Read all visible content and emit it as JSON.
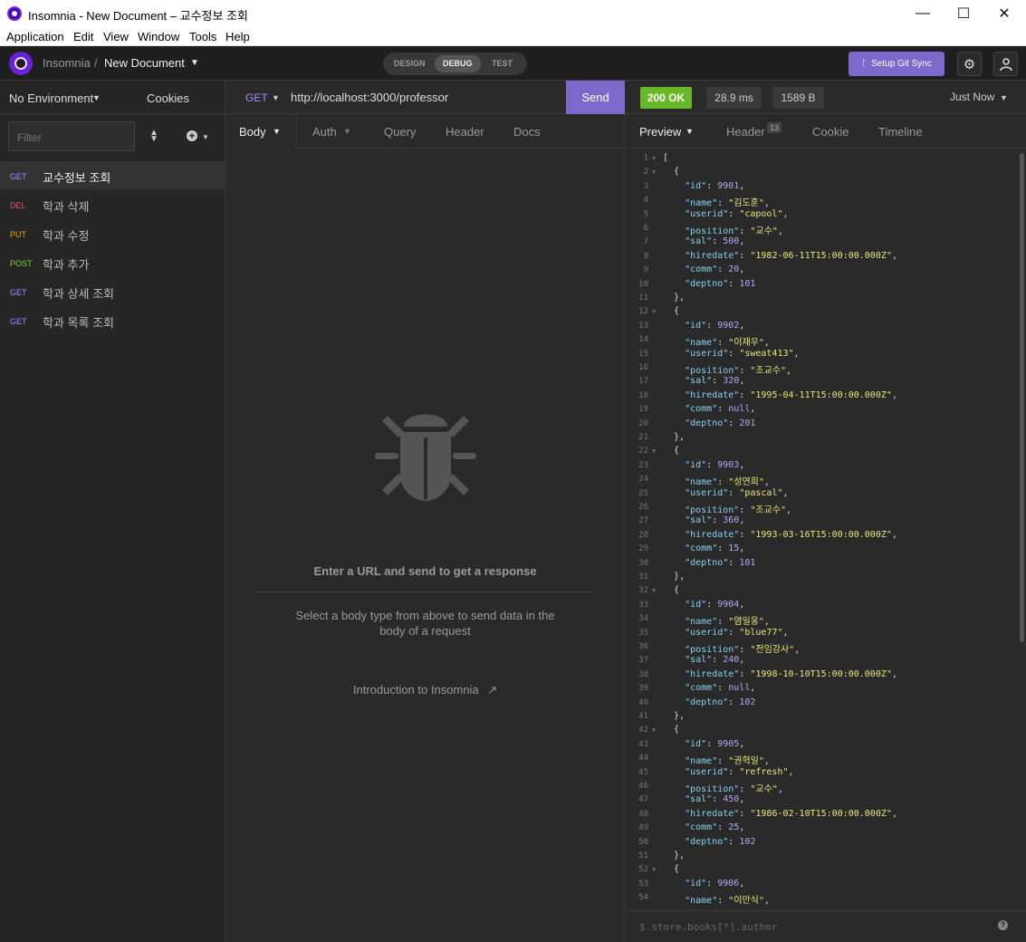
{
  "window": {
    "title": "Insomnia - New Document – 교수정보 조회",
    "minimize": "—",
    "maximize": "☐",
    "close": "✕"
  },
  "menu": [
    "Application",
    "Edit",
    "View",
    "Window",
    "Tools",
    "Help"
  ],
  "header": {
    "app_name": "Insomnia",
    "separator": "/",
    "document": "New Document",
    "tabs": [
      "DESIGN",
      "DEBUG",
      "TEST"
    ],
    "active_tab": "DEBUG",
    "git_button": "Setup Git Sync"
  },
  "sidebar": {
    "environment": "No Environment",
    "cookies": "Cookies",
    "filter_placeholder": "Filter",
    "items": [
      {
        "method": "GET",
        "name": "교수정보 조회",
        "color": "#a78bfa",
        "active": true
      },
      {
        "method": "DEL",
        "name": "학과 삭제",
        "color": "#ef5350",
        "active": false
      },
      {
        "method": "PUT",
        "name": "학과 수정",
        "color": "#f59e0b",
        "active": false
      },
      {
        "method": "POST",
        "name": "학과 추가",
        "color": "#7ed321",
        "active": false
      },
      {
        "method": "GET",
        "name": "학과 상세 조회",
        "color": "#a78bfa",
        "active": false
      },
      {
        "method": "GET",
        "name": "학과 목록 조회",
        "color": "#a78bfa",
        "active": false
      }
    ]
  },
  "request": {
    "method": "GET",
    "url": "http://localhost:3000/professor",
    "send": "Send",
    "tabs": [
      "Body",
      "Auth",
      "Query",
      "Header",
      "Docs"
    ],
    "empty_title": "Enter a URL and send to get a response",
    "empty_desc": "Select a body type from above to send data in the body of a request",
    "intro_link": "Introduction to Insomnia"
  },
  "response": {
    "status": "200 OK",
    "status_color": "#69b827",
    "time": "28.9 ms",
    "size": "1589 B",
    "when": "Just Now",
    "tabs": [
      "Preview",
      "Header",
      "Cookie",
      "Timeline"
    ],
    "header_count": "13",
    "filter_placeholder": "$.store.books[*].author",
    "help": "?",
    "lines": [
      "[",
      "  {",
      "    \"id\": 9901,",
      "    \"name\": \"김도훈\",",
      "    \"userid\": \"capool\",",
      "    \"position\": \"교수\",",
      "    \"sal\": 500,",
      "    \"hiredate\": \"1982-06-11T15:00:00.000Z\",",
      "    \"comm\": 20,",
      "    \"deptno\": 101",
      "  },",
      "  {",
      "    \"id\": 9902,",
      "    \"name\": \"이재우\",",
      "    \"userid\": \"sweat413\",",
      "    \"position\": \"조교수\",",
      "    \"sal\": 320,",
      "    \"hiredate\": \"1995-04-11T15:00:00.000Z\",",
      "    \"comm\": null,",
      "    \"deptno\": 201",
      "  },",
      "  {",
      "    \"id\": 9903,",
      "    \"name\": \"성연희\",",
      "    \"userid\": \"pascal\",",
      "    \"position\": \"조교수\",",
      "    \"sal\": 360,",
      "    \"hiredate\": \"1993-03-16T15:00:00.000Z\",",
      "    \"comm\": 15,",
      "    \"deptno\": 101",
      "  },",
      "  {",
      "    \"id\": 9904,",
      "    \"name\": \"염일웅\",",
      "    \"userid\": \"blue77\",",
      "    \"position\": \"전임강사\",",
      "    \"sal\": 240,",
      "    \"hiredate\": \"1998-10-10T15:00:00.000Z\",",
      "    \"comm\": null,",
      "    \"deptno\": 102",
      "  },",
      "  {",
      "    \"id\": 9905,",
      "    \"name\": \"권혁일\",",
      "    \"userid\": \"refresh\",",
      "    \"position\": \"교수\",",
      "    \"sal\": 450,",
      "    \"hiredate\": \"1986-02-10T15:00:00.000Z\",",
      "    \"comm\": 25,",
      "    \"deptno\": 102",
      "  },",
      "  {",
      "    \"id\": 9906,",
      "    \"name\": \"이만식\","
    ]
  }
}
